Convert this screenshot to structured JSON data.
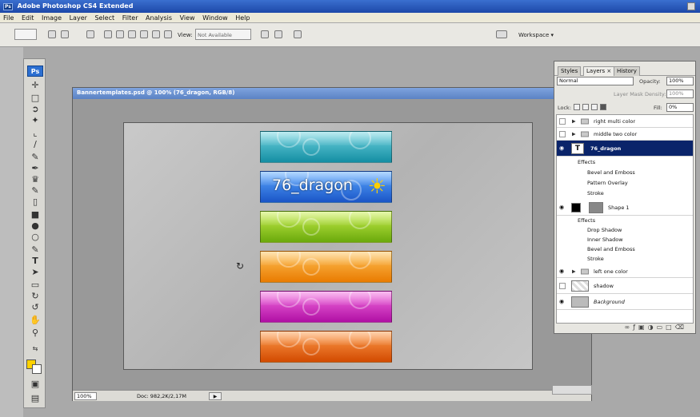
{
  "app": {
    "title": "Adobe Photoshop CS4 Extended",
    "icon_label": "Ps"
  },
  "menu": [
    "File",
    "Edit",
    "Image",
    "Layer",
    "Select",
    "Filter",
    "Analysis",
    "View",
    "Window",
    "Help"
  ],
  "options_bar": {
    "view_label": "View:",
    "view_value": "Not Available",
    "workspace_label": "Workspace ▾"
  },
  "tools_panel": {
    "logo": "Ps",
    "tools": [
      "move-tool",
      "marquee-tool",
      "lasso-tool",
      "magic-wand-tool",
      "crop-tool",
      "eyedropper-tool",
      "healing-brush-tool",
      "brush-tool",
      "clone-stamp-tool",
      "history-brush-tool",
      "eraser-tool",
      "gradient-tool",
      "blur-tool",
      "dodge-tool",
      "pen-tool",
      "type-tool",
      "path-selection-tool",
      "shape-tool",
      "3d-rotate-tool",
      "3d-orbit-tool",
      "hand-tool",
      "zoom-tool"
    ],
    "foreground_color": "#ffd200",
    "background_color": "#ffffff"
  },
  "document": {
    "title": "Bannertemplates.psd @ 100% (76_dragon, RGB/8)",
    "zoom": "100%",
    "doc_size": "Doc: 982,2K/2,17M",
    "banner_text": "76_dragon",
    "banners": [
      {
        "color_top": "#6fd3df",
        "color_bottom": "#148ea3"
      },
      {
        "color_top": "#5ba9ff",
        "color_bottom": "#1a55c7"
      },
      {
        "color_top": "#c7ee4a",
        "color_bottom": "#6aa90c"
      },
      {
        "color_top": "#ffc257",
        "color_bottom": "#e97b00"
      },
      {
        "color_top": "#f46ee0",
        "color_bottom": "#b00fa4"
      },
      {
        "color_top": "#ff9e4e",
        "color_bottom": "#d24a00"
      }
    ]
  },
  "layers_panel": {
    "tabs": [
      "Styles",
      "Layers ×",
      "History"
    ],
    "blend_mode": "Normal",
    "opacity_label": "Opacity:",
    "opacity_value": "100%",
    "layer_mask_density": "Layer Mask Density:",
    "layer_mask_value": "100%",
    "lock_label": "Lock:",
    "fill_label": "Fill:",
    "fill_value": "0%",
    "layers": [
      {
        "name": "right multi color",
        "type": "group",
        "visible": false
      },
      {
        "name": "middle two color",
        "type": "group",
        "visible": false
      },
      {
        "name": "76_dragon",
        "type": "text",
        "visible": true,
        "selected": true,
        "effects_label": "Effects",
        "effects": [
          "Bevel and Emboss",
          "Pattern Overlay",
          "Stroke"
        ]
      },
      {
        "name": "Shape 1",
        "type": "shape",
        "visible": true,
        "effects_label": "Effects",
        "effects": [
          "Drop Shadow",
          "Inner Shadow",
          "Bevel and Emboss",
          "Stroke"
        ]
      },
      {
        "name": "left one color",
        "type": "group",
        "visible": true
      },
      {
        "name": "shadow",
        "type": "image",
        "visible": false
      },
      {
        "name": "Background",
        "type": "background",
        "visible": true
      }
    ],
    "footer_icons": [
      "link-icon",
      "fx-icon",
      "mask-icon",
      "adjustment-icon",
      "new-group-icon",
      "new-layer-icon",
      "trash-icon"
    ]
  },
  "colors": {
    "titlebar": "#1d48a8",
    "selected_layer": "#0a246a"
  }
}
